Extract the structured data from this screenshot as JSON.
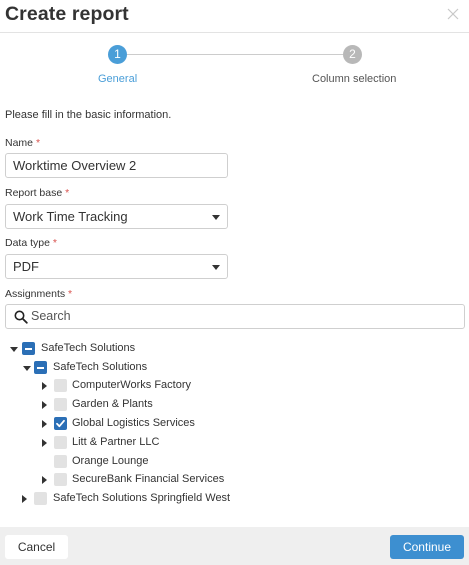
{
  "dialog": {
    "title": "Create report"
  },
  "steps": [
    {
      "number": "1",
      "label": "General",
      "state": "active"
    },
    {
      "number": "2",
      "label": "Column selection",
      "state": "inactive"
    }
  ],
  "intro_text": "Please fill in the basic information.",
  "form": {
    "name": {
      "label": "Name",
      "required_mark": "*",
      "value": "Worktime Overview 2"
    },
    "report_base": {
      "label": "Report base",
      "required_mark": "*",
      "value": "Work Time Tracking"
    },
    "data_type": {
      "label": "Data type",
      "required_mark": "*",
      "value": "PDF"
    },
    "assignments": {
      "label": "Assignments",
      "required_mark": "*",
      "search_placeholder": "Search"
    }
  },
  "tree": [
    {
      "label": "SafeTech Solutions",
      "state": "partial",
      "expander": "expanded"
    },
    {
      "label": "SafeTech Solutions",
      "state": "partial",
      "expander": "expanded"
    },
    {
      "label": "ComputerWorks Factory",
      "state": "unchecked",
      "expander": "collapsed"
    },
    {
      "label": "Garden & Plants",
      "state": "unchecked",
      "expander": "collapsed"
    },
    {
      "label": "Global Logistics Services",
      "state": "checked",
      "expander": "collapsed"
    },
    {
      "label": "Litt & Partner LLC",
      "state": "unchecked",
      "expander": "collapsed"
    },
    {
      "label": "Orange Lounge",
      "state": "unchecked",
      "expander": "none"
    },
    {
      "label": "SecureBank Financial Services",
      "state": "unchecked",
      "expander": "collapsed"
    },
    {
      "label": "SafeTech Solutions Springfield West",
      "state": "unchecked",
      "expander": "collapsed"
    }
  ],
  "footer": {
    "cancel_label": "Cancel",
    "continue_label": "Continue"
  },
  "colors": {
    "accent": "#4a9ed8",
    "primary_button": "#3d8fd0",
    "checkbox_fill": "#2b6fb6",
    "required": "#d9534f"
  }
}
